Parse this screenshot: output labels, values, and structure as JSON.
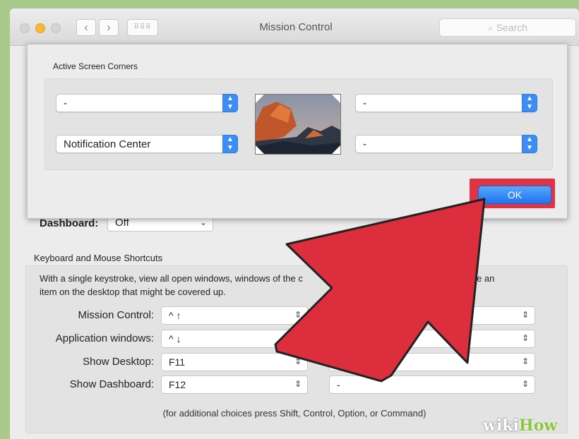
{
  "window": {
    "title": "Mission Control",
    "search_placeholder": "Search",
    "back_glyph": "‹",
    "forward_glyph": "›",
    "grid_glyph": "⠿⠿⠿"
  },
  "sheet": {
    "title": "Active Screen Corners",
    "top_left": "-",
    "top_right": "-",
    "bottom_left": "Notification Center",
    "bottom_right": "-",
    "ok_label": "OK"
  },
  "dashboard": {
    "label": "Dashboard:",
    "value": "Off"
  },
  "shortcuts": {
    "section_title": "Keyboard and Mouse Shortcuts",
    "description": "With a single keystroke, view all open windows, windows of the c… windows to locate an item on the desktop that might be covered up.",
    "desc_line1_a": "With a single keystroke, view all open windows, windows of the c",
    "desc_line1_b": "e windows to locate an",
    "desc_line2": "item on the desktop that might be covered up.",
    "rows": [
      {
        "label": "Mission Control:",
        "key": "^ ↑",
        "mouse": ""
      },
      {
        "label": "Application windows:",
        "key": "^ ↓",
        "mouse": "-"
      },
      {
        "label": "Show Desktop:",
        "key": "F11",
        "mouse": "-"
      },
      {
        "label": "Show Dashboard:",
        "key": "F12",
        "mouse": "-"
      }
    ],
    "footer": "(for additional choices press Shift, Control, Option, or Command)"
  },
  "watermark": {
    "wiki": "wiki",
    "how": "How"
  },
  "colors": {
    "traffic_close": "#d6d6d6",
    "traffic_min": "#f5b938",
    "traffic_max": "#d6d6d6",
    "accent_blue": "#3c8ef6",
    "highlight_red": "#e03345",
    "arrow_red": "#dc2e3c"
  },
  "icons": {
    "stepper": "⌃⌄",
    "popup_arrows": "chevron-up-down-icon"
  }
}
